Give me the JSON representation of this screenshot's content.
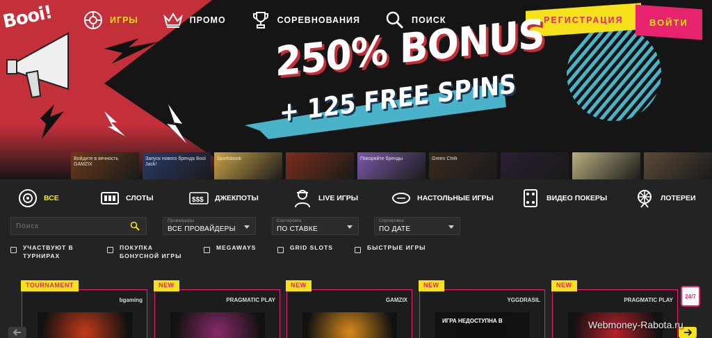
{
  "logo": {
    "text": "Booi!"
  },
  "nav": {
    "items": [
      {
        "label": "ИГРЫ",
        "icon": "roulette-chip-icon",
        "active": true
      },
      {
        "label": "ПРОМО",
        "icon": "crown-icon",
        "active": false
      },
      {
        "label": "СОРЕВНОВАНИЯ",
        "icon": "trophy-icon",
        "active": false
      },
      {
        "label": "ПОИСК",
        "icon": "search-icon",
        "active": false
      }
    ]
  },
  "auth": {
    "register_label": "РЕГИСТРАЦИЯ",
    "login_label": "ВОЙТИ"
  },
  "hero": {
    "bonus": "250% BONUS",
    "spins": "+ 125 FREE SPINS"
  },
  "thumbnails": [
    {
      "title": "Войдите в вечность GAMZIX",
      "color": "#6b3a1a"
    },
    {
      "title": "Запуск нового бренда Booi Jack!",
      "color": "#2a3b6a"
    },
    {
      "title": "Sportsbook",
      "color": "#c9a248"
    },
    {
      "title": "",
      "color": "#7a2d1a"
    },
    {
      "title": "Покоряйте бренды",
      "color": "#7a5aa8"
    },
    {
      "title": "Green Chilli",
      "color": "#3a2a1e"
    },
    {
      "title": "",
      "color": "#2a1e30"
    },
    {
      "title": "",
      "color": "#b8b080"
    },
    {
      "title": "",
      "color": "#5a4a3a"
    }
  ],
  "categories": [
    {
      "label": "ВСЕ",
      "icon": "all-games-icon",
      "active": true
    },
    {
      "label": "СЛОТЫ",
      "icon": "slot-machine-icon",
      "active": false
    },
    {
      "label": "ДЖЕКПОТЫ",
      "icon": "jackpot-icon",
      "active": false
    },
    {
      "label": "LIVE ИГРЫ",
      "icon": "live-dealer-icon",
      "active": false
    },
    {
      "label": "НАСТОЛЬНЫЕ ИГРЫ",
      "icon": "table-games-icon",
      "active": false
    },
    {
      "label": "ВИДЕО ПОКЕРЫ",
      "icon": "video-poker-icon",
      "active": false
    },
    {
      "label": "ЛОТЕРЕИ",
      "icon": "lottery-wheel-icon",
      "active": false
    }
  ],
  "filters": {
    "search_placeholder": "Поиск",
    "providers": {
      "caption": "Провайдеры",
      "value": "ВСЕ ПРОВАЙДЕРЫ"
    },
    "sort1": {
      "caption": "Сортировка",
      "value": "ПО СТАВКЕ"
    },
    "sort2": {
      "caption": "Сортировка",
      "value": "ПО ДАТЕ"
    }
  },
  "checkboxes": [
    {
      "label": "УЧАСТВУЮТ В ТУРНИРАХ"
    },
    {
      "label": "ПОКУПКА БОНУСНОЙ ИГРЫ"
    },
    {
      "label": "MEGAWAYS"
    },
    {
      "label": "GRID SLOTS"
    },
    {
      "label": "БЫСТРЫЕ ИГРЫ"
    }
  ],
  "cards": [
    {
      "badge": "TOURNAMENT",
      "provider": "bgaming",
      "art_text": "",
      "color": "#c43a1a"
    },
    {
      "badge": "NEW",
      "provider": "PRAGMATIC PLAY",
      "art_text": "",
      "color": "#8a2a6a"
    },
    {
      "badge": "NEW",
      "provider": "GAMZIX",
      "art_text": "",
      "color": "#d88a1a"
    },
    {
      "badge": "NEW",
      "provider": "YGGDRASIL",
      "art_text": "ИГРА НЕДОСТУПНА В",
      "color": "#101010"
    },
    {
      "badge": "NEW",
      "provider": "PRAGMATIC PLAY",
      "art_text": "",
      "color": "#b8202a"
    }
  ],
  "support": {
    "label": "24/7"
  },
  "watermark": "Webmoney-Rabota.ru",
  "colors": {
    "accent_yellow": "#f5e21a",
    "accent_pink": "#e8236e",
    "hero_red": "#c4303a",
    "band_blue": "#4ab3c9"
  }
}
